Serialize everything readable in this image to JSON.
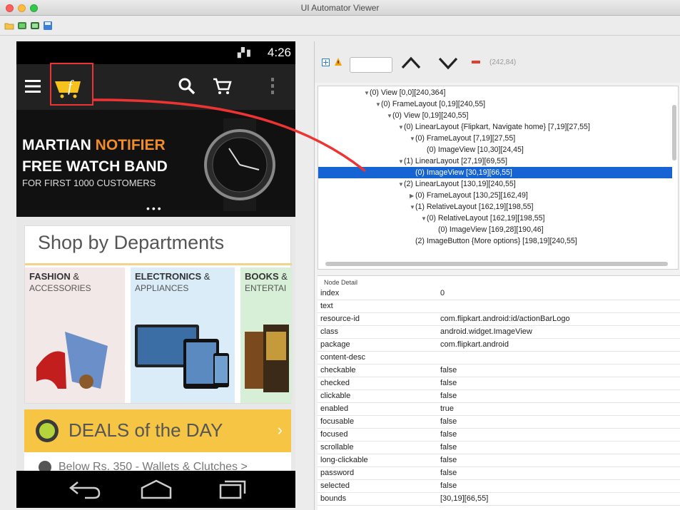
{
  "window": {
    "title": "UI Automator Viewer"
  },
  "colors": {
    "selection": "#1663d4",
    "highlight": "#ee3333",
    "deals_bg": "#f5c543"
  },
  "phone": {
    "status_time": "4:26",
    "banner": {
      "line1_white": "MARTIAN ",
      "line1_orange": "NOTIFIER",
      "line2": "FREE WATCH BAND",
      "line3": "FOR FIRST 1000 CUSTOMERS",
      "dots": "•••"
    },
    "shop_title": "Shop by Departments",
    "departments": [
      {
        "name": "FASHION",
        "amp": " &",
        "sub": "ACCESSORIES"
      },
      {
        "name": "ELECTRONICS",
        "amp": " &",
        "sub": "APPLIANCES"
      },
      {
        "name": "BOOKS",
        "amp": " &",
        "sub": "ENTERTAI"
      }
    ],
    "deals": {
      "label": "DEALS of the DAY",
      "chevron": "›",
      "sub": "Below Rs. 350 - Wallets & Clutches >"
    }
  },
  "inspector": {
    "find_value": "",
    "coordinates": "(242,84)",
    "tree": [
      {
        "text": "(0) View [0,0][240,364]",
        "toggle": "▼"
      },
      {
        "text": "(0) FrameLayout [0,19][240,55]",
        "toggle": "▼"
      },
      {
        "text": "(0) View [0,19][240,55]",
        "toggle": "▼"
      },
      {
        "text": "(0) LinearLayout {Flipkart, Navigate home} [7,19][27,55]",
        "toggle": "▼"
      },
      {
        "text": "(0) FrameLayout [7,19][27,55]",
        "toggle": "▼"
      },
      {
        "text": "(0) ImageView [10,30][24,45]",
        "toggle": ""
      },
      {
        "text": "(1) LinearLayout [27,19][69,55]",
        "toggle": "▼"
      },
      {
        "text": "(0) ImageView [30,19][66,55]",
        "toggle": ""
      },
      {
        "text": "(2) LinearLayout [130,19][240,55]",
        "toggle": "▼"
      },
      {
        "text": "(0) FrameLayout [130,25][162,49]",
        "toggle": "▶"
      },
      {
        "text": "(1) RelativeLayout [162,19][198,55]",
        "toggle": "▼"
      },
      {
        "text": "(0) RelativeLayout [162,19][198,55]",
        "toggle": "▼"
      },
      {
        "text": "(0) ImageView [169,28][190,46]",
        "toggle": ""
      },
      {
        "text": "(2) ImageButton {More options} [198,19][240,55]",
        "toggle": ""
      }
    ],
    "node_detail_header": "Node Detail",
    "properties": [
      {
        "key": "index",
        "value": "0"
      },
      {
        "key": "text",
        "value": ""
      },
      {
        "key": "resource-id",
        "value": "com.flipkart.android:id/actionBarLogo"
      },
      {
        "key": "class",
        "value": "android.widget.ImageView"
      },
      {
        "key": "package",
        "value": "com.flipkart.android"
      },
      {
        "key": "content-desc",
        "value": ""
      },
      {
        "key": "checkable",
        "value": "false"
      },
      {
        "key": "checked",
        "value": "false"
      },
      {
        "key": "clickable",
        "value": "false"
      },
      {
        "key": "enabled",
        "value": "true"
      },
      {
        "key": "focusable",
        "value": "false"
      },
      {
        "key": "focused",
        "value": "false"
      },
      {
        "key": "scrollable",
        "value": "false"
      },
      {
        "key": "long-clickable",
        "value": "false"
      },
      {
        "key": "password",
        "value": "false"
      },
      {
        "key": "selected",
        "value": "false"
      },
      {
        "key": "bounds",
        "value": "[30,19][66,55]"
      }
    ]
  }
}
